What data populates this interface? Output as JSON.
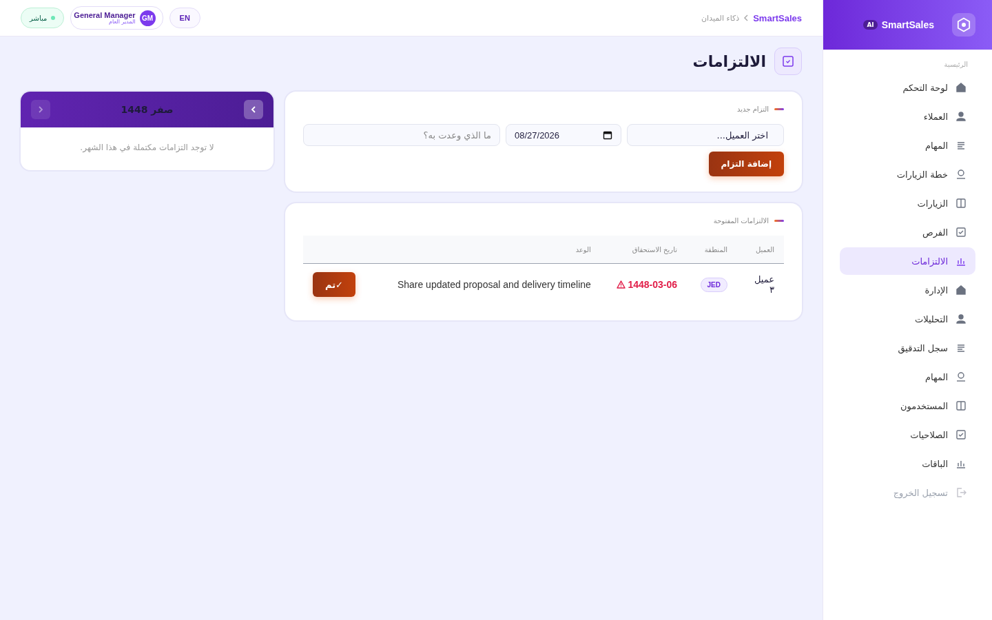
{
  "brand": {
    "name": "SmartSales",
    "badge": "AI"
  },
  "breadcrumb": [
    "SmartSales",
    "ذكاء الميدان"
  ],
  "topbar": {
    "language": "EN",
    "user": {
      "initials": "GM",
      "name": "General Manager",
      "role": "المدير العام"
    },
    "status": "مباشر"
  },
  "sidebar": {
    "section": "الرئيسية",
    "items": [
      {
        "label": "لوحة التحكم",
        "selected": false
      },
      {
        "label": "العملاء",
        "selected": false
      },
      {
        "label": "المهام",
        "selected": false
      },
      {
        "label": "خطة الزيارات",
        "selected": false
      },
      {
        "label": "الزيارات",
        "selected": false
      },
      {
        "label": "الفرص",
        "selected": false
      },
      {
        "label": "الالتزامات",
        "selected": true
      },
      {
        "label": "الإدارة",
        "selected": false
      },
      {
        "label": "التحليلات",
        "selected": false
      },
      {
        "label": "سجل التدقيق",
        "selected": false
      },
      {
        "label": "المهام",
        "selected": false
      },
      {
        "label": "المستخدمون",
        "selected": false
      },
      {
        "label": "الصلاحيات",
        "selected": false
      },
      {
        "label": "الباقات",
        "selected": false
      }
    ],
    "logout": "تسجيل الخروج"
  },
  "page": {
    "title": "الالتزامات"
  },
  "new_form": {
    "title": "التزام جديد",
    "client": "اختر العميل...",
    "date": "08/27/2026",
    "promise_placeholder": "ما الذي وعدت به؟",
    "submit": "إضافة التزام"
  },
  "open_list": {
    "title": "الالتزامات المفتوحة",
    "columns": [
      "العميل",
      "المنطقة",
      "تاريخ الاستحقاق",
      "الوعد"
    ],
    "rows": [
      {
        "client": "عميل ٣",
        "region": "JED",
        "due": "1448-03-06",
        "overdue": true,
        "promise": "Share updated proposal and delivery timeline",
        "action": "✓تم"
      }
    ]
  },
  "calendar": {
    "month": "صفر 1448",
    "prev_disabled": true,
    "next_disabled": false,
    "empty": "لا توجد التزامات مكتملة في هذا الشهر."
  }
}
